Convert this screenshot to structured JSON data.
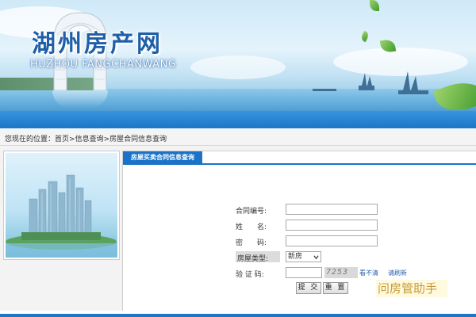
{
  "banner": {
    "title_cn": "湖州房产网",
    "title_en": "HUZHOU FANGCHANWANG"
  },
  "breadcrumb": {
    "prefix": "您现在的位置：",
    "home": "首页",
    "sep": ">",
    "info_query": "信息查询",
    "current": "房屋合同信息查询"
  },
  "tab": {
    "label": "房屋买卖合同信息查询"
  },
  "form": {
    "contract_no_label": "合同编号:",
    "contract_no_value": "",
    "name_label": "姓　　名:",
    "name_value": "",
    "password_label": "密　　码:",
    "password_value": "",
    "house_type_label": "房屋类型:",
    "house_type_selected": "新房",
    "captcha_label": "验 证 码:",
    "captcha_value": "",
    "captcha_image_text": "7253",
    "cant_see_link": "看不清",
    "refresh_link": "请刷新",
    "submit_label": "提 交",
    "reset_label": "重 置"
  },
  "watermark": {
    "text": "问房管助手"
  },
  "colors": {
    "accent": "#1a73c8",
    "title_blue": "#1f5fa8",
    "link": "#2a62b0"
  }
}
